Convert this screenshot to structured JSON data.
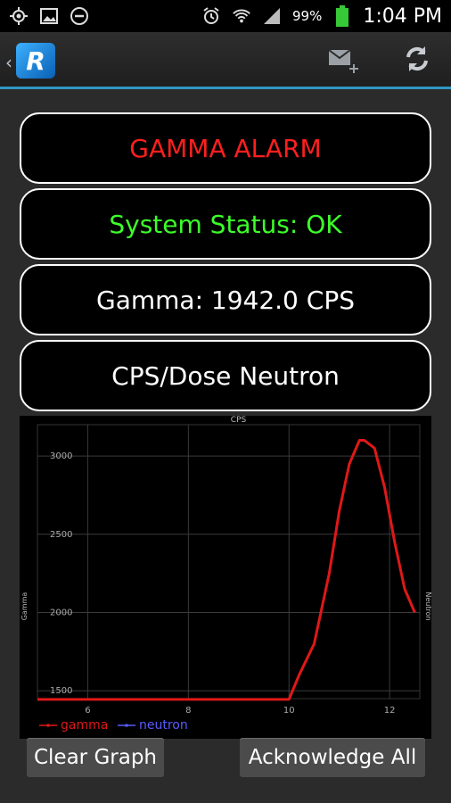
{
  "statusbar": {
    "battery_pct": "99%",
    "clock": "1:04 PM"
  },
  "panels": {
    "alarm": "GAMMA ALARM",
    "system_status": "System Status: OK",
    "gamma": "Gamma: 1942.0 CPS",
    "cps_dose": "CPS/Dose Neutron"
  },
  "chart_data": {
    "type": "line",
    "title": "CPS",
    "ylabel": "Gamma",
    "ylabel_right": "Neutron",
    "xlim": [
      5.0,
      12.6
    ],
    "ylim": [
      1450,
      3200
    ],
    "xticks": [
      6,
      8,
      10,
      12
    ],
    "yticks": [
      1500,
      2000,
      2500,
      3000
    ],
    "grid": true,
    "legend": "bottom-left",
    "series": [
      {
        "name": "gamma",
        "color": "#e01818",
        "x": [
          5.0,
          6.0,
          7.0,
          8.0,
          9.0,
          10.0,
          10.2,
          10.5,
          10.8,
          11.0,
          11.2,
          11.4,
          11.5,
          11.7,
          11.9,
          12.1,
          12.3,
          12.5
        ],
        "y": [
          1445,
          1445,
          1445,
          1445,
          1445,
          1445,
          1600,
          1800,
          2250,
          2650,
          2950,
          3100,
          3100,
          3050,
          2800,
          2450,
          2150,
          2000
        ]
      },
      {
        "name": "neutron",
        "color": "#5a5aff",
        "x": [],
        "y": []
      }
    ]
  },
  "buttons": {
    "clear_graph": "Clear Graph",
    "acknowledge_all": "Acknowledge All"
  }
}
